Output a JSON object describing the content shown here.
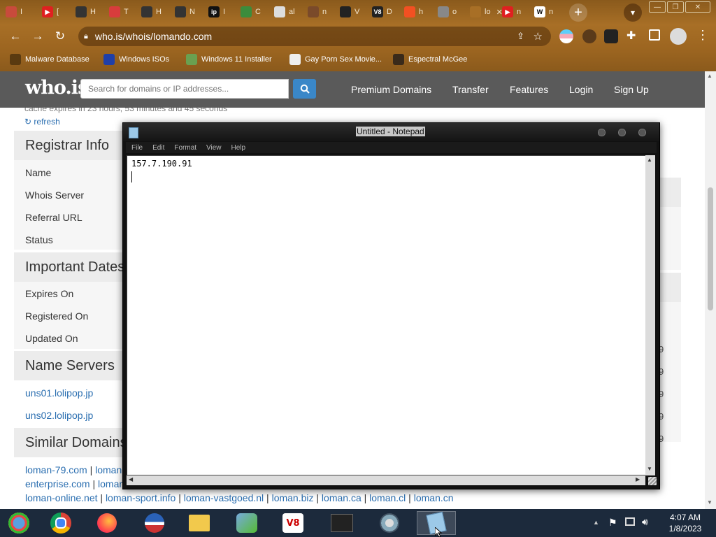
{
  "browser": {
    "tabs": [
      {
        "label": "I",
        "fav_color": "#c84b3c",
        "fav_glyph": ""
      },
      {
        "label": "[",
        "fav_color": "#e02020",
        "fav_glyph": "▶"
      },
      {
        "label": "H",
        "fav_color": "#333333",
        "fav_glyph": ""
      },
      {
        "label": "T",
        "fav_color": "#d83c3c",
        "fav_glyph": ""
      },
      {
        "label": "H",
        "fav_color": "#333333",
        "fav_glyph": ""
      },
      {
        "label": "N",
        "fav_color": "#333333",
        "fav_glyph": ""
      },
      {
        "label": "I",
        "fav_color": "#111111",
        "fav_glyph": "ip"
      },
      {
        "label": "C",
        "fav_color": "#3c8c3c",
        "fav_glyph": ""
      },
      {
        "label": "al",
        "fav_color": "#dddddd",
        "fav_glyph": ""
      },
      {
        "label": "n",
        "fav_color": "#7a4a2a",
        "fav_glyph": ""
      },
      {
        "label": "V",
        "fav_color": "#222222",
        "fav_glyph": ""
      },
      {
        "label": "D",
        "fav_color": "#222222",
        "fav_glyph": "V8"
      },
      {
        "label": "h",
        "fav_color": "#f25022",
        "fav_glyph": ""
      },
      {
        "label": "o",
        "fav_color": "#888888",
        "fav_glyph": ""
      },
      {
        "label": "lo",
        "fav_color": "#a86f26",
        "fav_glyph": ""
      },
      {
        "label": "n",
        "fav_color": "#e02020",
        "fav_glyph": "▶"
      },
      {
        "label": "n",
        "fav_color": "#ffffff",
        "fav_glyph": "W"
      }
    ],
    "url": "who.is/whois/lomando.com",
    "bookmarks": [
      {
        "label": "Malware Database"
      },
      {
        "label": "Windows ISOs"
      },
      {
        "label": "Windows 11 Installer"
      },
      {
        "label": "Gay Porn Sex Movie..."
      },
      {
        "label": "Espectral McGee"
      }
    ]
  },
  "site": {
    "logo": "who.is",
    "search_placeholder": "Search for domains or IP addresses...",
    "nav": [
      "Premium Domains",
      "Transfer",
      "Features",
      "Login",
      "Sign Up"
    ],
    "cache_text": "cache expires in 23 hours, 53 minutes and 45 seconds",
    "refresh_label": "refresh",
    "registrar_title": "Registrar Info",
    "registrar_rows": [
      "Name",
      "Whois Server",
      "Referral URL",
      "Status"
    ],
    "dates_title": "Important Dates",
    "dates_rows": [
      "Expires On",
      "Registered On",
      "Updated On"
    ],
    "ns_title": "Name Servers",
    "ns_rows": [
      "uns01.lolipop.jp",
      "uns02.lolipop.jp"
    ],
    "similar_title": "Similar Domains",
    "similar_line1": [
      "loman-79.com",
      "loman"
    ],
    "similar_line2": [
      "enterprise.com",
      "loman"
    ],
    "similar_line3": [
      "loman-online.net",
      "loman-sport.info",
      "loman-vastgoed.nl",
      "loman.biz",
      "loman.ca",
      "loman.cl",
      "loman.cn"
    ],
    "right_digits": [
      "9",
      "9",
      "9",
      "9",
      "9"
    ]
  },
  "notepad": {
    "title": "Untitled - Notepad",
    "menu": [
      "File",
      "Edit",
      "Format",
      "View",
      "Help"
    ],
    "text": "157.7.190.91"
  },
  "taskbar": {
    "time": "4:07 AM",
    "date": "1/8/2023"
  }
}
